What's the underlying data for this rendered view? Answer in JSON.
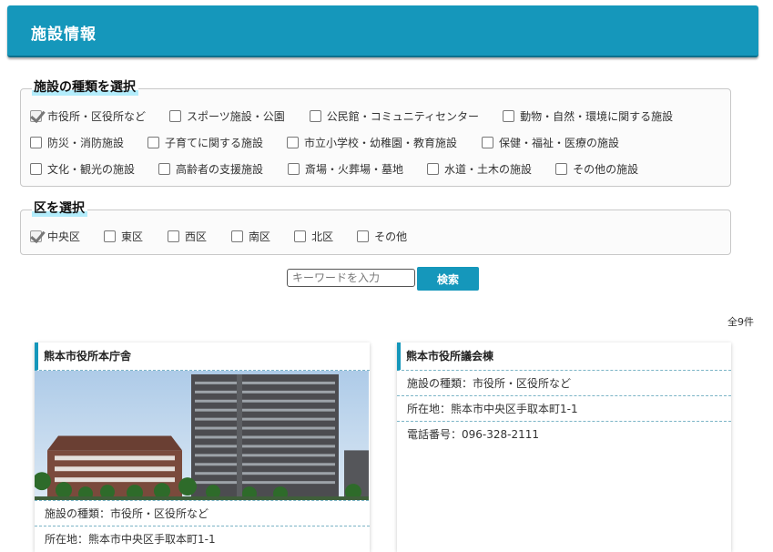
{
  "header": {
    "title": "施設情報"
  },
  "facility_types": {
    "legend": "施設の種類を選択",
    "rows": [
      [
        {
          "label": "市役所・区役所など",
          "checked": true
        },
        {
          "label": "スポーツ施設・公園",
          "checked": false
        },
        {
          "label": "公民館・コミュニティセンター",
          "checked": false
        },
        {
          "label": "動物・自然・環境に関する施設",
          "checked": false
        }
      ],
      [
        {
          "label": "防災・消防施設",
          "checked": false
        },
        {
          "label": "子育てに関する施設",
          "checked": false
        },
        {
          "label": "市立小学校・幼稚園・教育施設",
          "checked": false
        },
        {
          "label": "保健・福祉・医療の施設",
          "checked": false
        }
      ],
      [
        {
          "label": "文化・観光の施設",
          "checked": false
        },
        {
          "label": "高齢者の支援施設",
          "checked": false
        },
        {
          "label": "斎場・火葬場・墓地",
          "checked": false
        },
        {
          "label": "水道・土木の施設",
          "checked": false
        },
        {
          "label": "その他の施設",
          "checked": false
        }
      ]
    ]
  },
  "wards": {
    "legend": "区を選択",
    "options": [
      {
        "label": "中央区",
        "checked": true
      },
      {
        "label": "東区",
        "checked": false
      },
      {
        "label": "西区",
        "checked": false
      },
      {
        "label": "南区",
        "checked": false
      },
      {
        "label": "北区",
        "checked": false
      },
      {
        "label": "その他",
        "checked": false
      }
    ]
  },
  "search": {
    "placeholder": "キーワードを入力",
    "button_label": "検索"
  },
  "results": {
    "count_label": "全9件",
    "cards": [
      {
        "title": "熊本市役所本庁舎",
        "has_photo": true,
        "type_label": "施設の種類：市役所・区役所など",
        "address_label": "所在地：熊本市中央区手取本町1-1"
      },
      {
        "title": "熊本市役所議会棟",
        "has_photo": false,
        "type_label": "施設の種類：市役所・区役所など",
        "address_label": "所在地：熊本市中央区手取本町1-1",
        "phone_label": "電話番号：096-328-2111"
      }
    ]
  }
}
